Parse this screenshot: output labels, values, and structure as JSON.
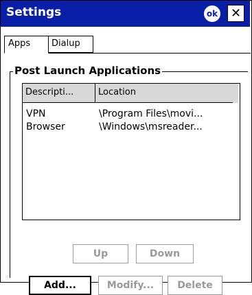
{
  "window": {
    "title": "Settings",
    "ok_label": "ok",
    "close_label": "✕"
  },
  "tabs": [
    {
      "label": "Apps",
      "active": true
    },
    {
      "label": "Dialup",
      "active": false
    }
  ],
  "group": {
    "title": "Post Launch Applications"
  },
  "list": {
    "columns": [
      "Descripti...",
      "Location"
    ],
    "rows": [
      {
        "description": "VPN",
        "location": "\\Program Files\\movi..."
      },
      {
        "description": "Browser",
        "location": "\\Windows\\msreader..."
      }
    ]
  },
  "buttons": {
    "up": "Up",
    "down": "Down",
    "add": "Add...",
    "modify": "Modify...",
    "delete": "Delete"
  }
}
